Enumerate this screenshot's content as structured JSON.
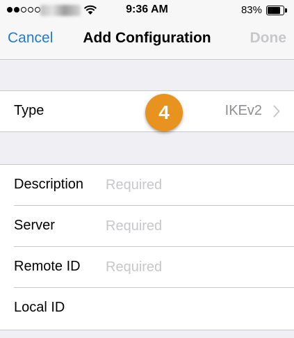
{
  "status_bar": {
    "time": "9:36 AM",
    "battery_percent": "83%",
    "signal_icon": "signal-dots-icon",
    "wifi_icon": "wifi-icon",
    "battery_icon": "battery-icon"
  },
  "nav": {
    "cancel_label": "Cancel",
    "title": "Add Configuration",
    "done_label": "Done"
  },
  "type_row": {
    "label": "Type",
    "value": "IKEv2",
    "icon": "chevron-right-icon"
  },
  "badge": {
    "number": "4"
  },
  "form": {
    "description": {
      "label": "Description",
      "placeholder": "Required",
      "value": ""
    },
    "server": {
      "label": "Server",
      "placeholder": "Required",
      "value": ""
    },
    "remote_id": {
      "label": "Remote ID",
      "placeholder": "Required",
      "value": ""
    },
    "local_id": {
      "label": "Local ID",
      "placeholder": "",
      "value": ""
    }
  },
  "colors": {
    "accent": "#1f7ad6",
    "disabled": "#c7c7cc",
    "badge": "#e8931f",
    "background": "#efeff4"
  }
}
